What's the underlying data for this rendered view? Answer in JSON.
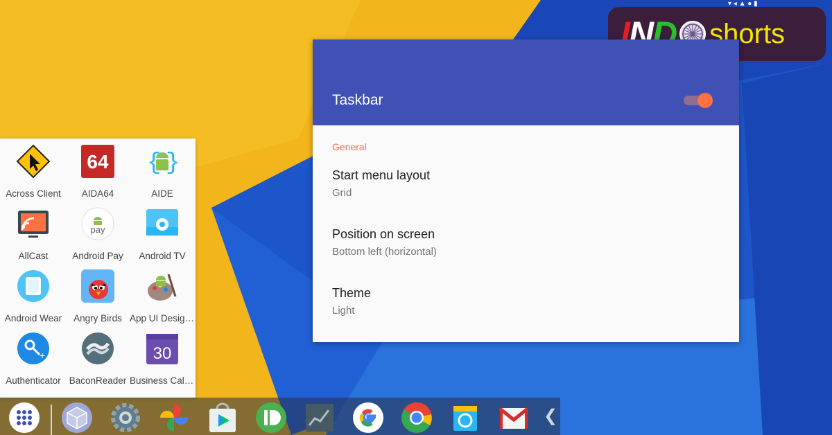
{
  "logo": {
    "text_ind": "IND",
    "text_shorts": "shorts"
  },
  "settings": {
    "title": "Taskbar",
    "toggle_on": true,
    "section": "General",
    "prefs": [
      {
        "title": "Start menu layout",
        "summary": "Grid"
      },
      {
        "title": "Position on screen",
        "summary": "Bottom left (horizontal)"
      },
      {
        "title": "Theme",
        "summary": "Light"
      }
    ]
  },
  "start_menu": {
    "apps": [
      {
        "label": "Across Client",
        "icon": "across-client-icon"
      },
      {
        "label": "AIDA64",
        "icon": "aida64-icon"
      },
      {
        "label": "AIDE",
        "icon": "aide-icon"
      },
      {
        "label": "AllCast",
        "icon": "allcast-icon"
      },
      {
        "label": "Android Pay",
        "icon": "android-pay-icon"
      },
      {
        "label": "Android TV",
        "icon": "android-tv-icon"
      },
      {
        "label": "Android Wear",
        "icon": "android-wear-icon"
      },
      {
        "label": "Angry Birds",
        "icon": "angry-birds-icon"
      },
      {
        "label": "App UI Designer",
        "icon": "app-ui-designer-icon"
      },
      {
        "label": "Authenticator",
        "icon": "authenticator-icon"
      },
      {
        "label": "BaconReader",
        "icon": "baconreader-icon"
      },
      {
        "label": "Business Calendar",
        "icon": "business-calendar-icon"
      }
    ],
    "icon_text": {
      "aida": "64",
      "pay": "pay",
      "calendar": "30"
    }
  },
  "taskbar": {
    "items": [
      "app-drawer-icon",
      "cube-icon",
      "settings-gear-icon",
      "photos-pinwheel-icon",
      "play-store-icon",
      "pushbullet-icon",
      "stocks-chart-icon",
      "google-icon",
      "chrome-icon",
      "files-icon",
      "gmail-icon"
    ],
    "collapse_glyph": "❮"
  },
  "colors": {
    "header": "#3f51b5",
    "accent": "#ff6e40",
    "wallpaper_yellow": "#f2b51c",
    "wallpaper_blue": "#1e4fc4"
  }
}
